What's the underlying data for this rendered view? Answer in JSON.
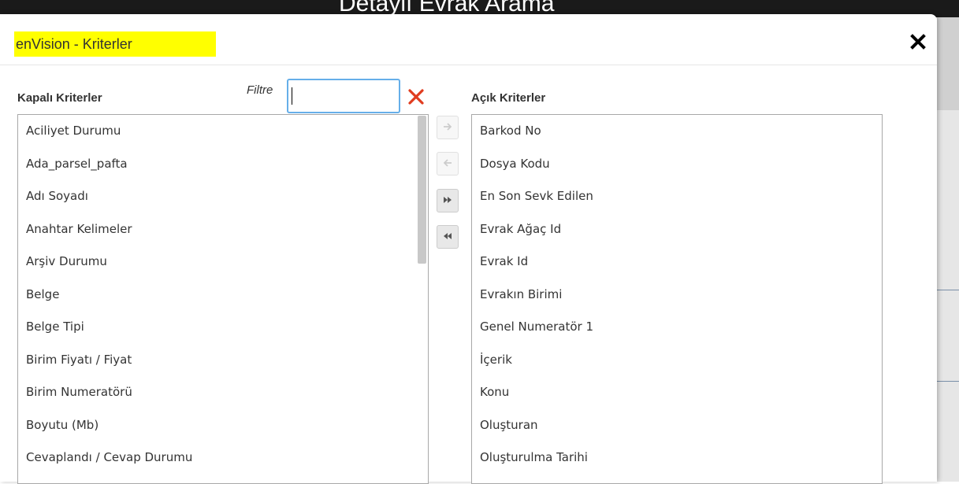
{
  "background": {
    "page_title": "Detaylı Evrak Arama"
  },
  "dialog": {
    "title": "enVision - Kriterler",
    "close_icon": "close-icon"
  },
  "left_panel": {
    "label": "Kapalı Kriterler",
    "filter_label": "Filtre",
    "filter_value": "",
    "clear_icon": "clear-x-icon",
    "items": [
      "Aciliyet Durumu",
      "Ada_parsel_pafta",
      "Adı Soyadı",
      "Anahtar Kelimeler",
      "Arşiv Durumu",
      "Belge",
      "Belge Tipi",
      "Birim Fiyatı / Fiyat",
      "Birim Numeratörü",
      "Boyutu (Mb)",
      "Cevaplandı / Cevap Durumu"
    ]
  },
  "transfer_buttons": [
    {
      "icon": "arrow-right-icon",
      "state": "disabled"
    },
    {
      "icon": "arrow-left-icon",
      "state": "disabled"
    },
    {
      "icon": "double-arrow-right-icon",
      "state": "enabled"
    },
    {
      "icon": "double-arrow-left-icon",
      "state": "enabled"
    }
  ],
  "right_panel": {
    "label": "Açık Kriterler",
    "items": [
      "Barkod No",
      "Dosya Kodu",
      "En Son Sevk Edilen",
      "Evrak Ağaç Id",
      "Evrak Id",
      "Evrakın Birimi",
      "Genel Numeratör 1",
      "İçerik",
      "Konu",
      "Oluşturan",
      "Oluşturulma Tarihi"
    ]
  },
  "colors": {
    "title_highlight": "#ffff00",
    "focus_border": "#66afe9",
    "clear_icon": "#e03c1f"
  }
}
